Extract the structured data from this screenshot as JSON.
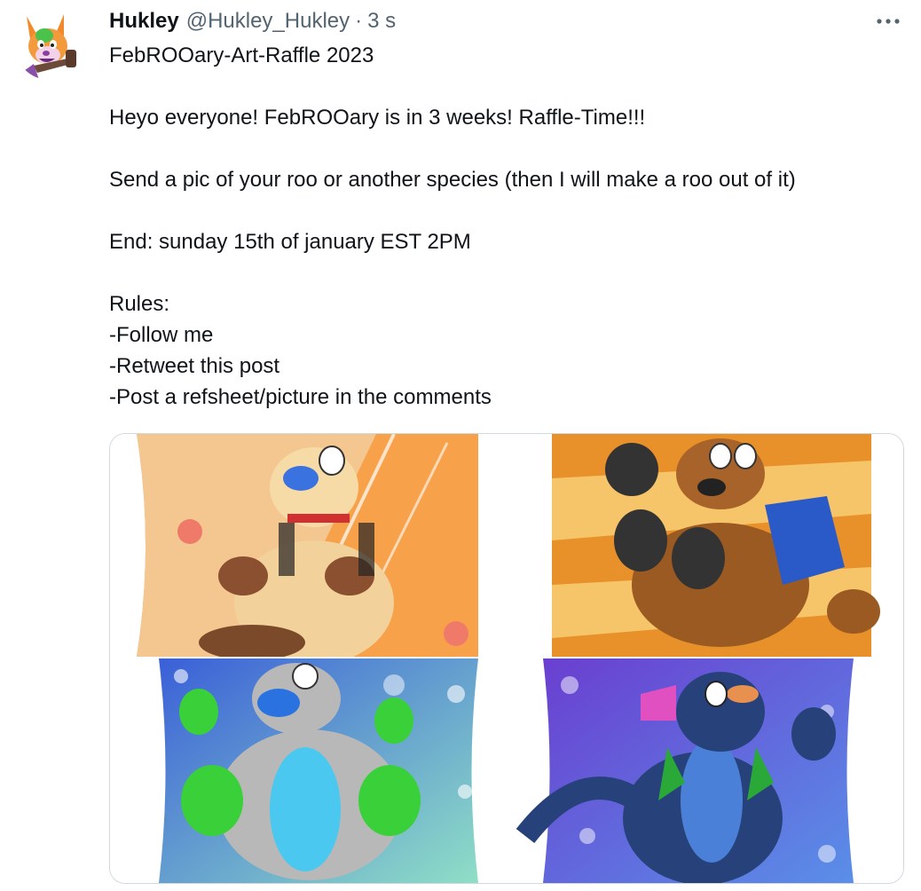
{
  "tweet": {
    "author_name": "Hukley",
    "author_handle": "@Hukley_Hukley",
    "separator": "·",
    "timestamp": "3 s",
    "lines": [
      "FebROOary-Art-Raffle 2023",
      "",
      "Heyo everyone! FebROOary is in 3 weeks! Raffle-Time!!!",
      "",
      "Send a pic of your roo or another species (then I will make a roo out of it)",
      "",
      "End: sunday 15th of january EST 2PM",
      "",
      "Rules:",
      "-Follow me",
      "-Retweet this post",
      "-Post a refsheet/picture in the comments"
    ]
  },
  "icons": {
    "more": "more-horizontal-icon",
    "avatar": "kangaroo-avatar"
  },
  "media": {
    "images": [
      {
        "name": "tan-kangaroo-art",
        "colors": [
          "#f7a24a",
          "#f4c690"
        ]
      },
      {
        "name": "brown-kangaroo-art",
        "colors": [
          "#e8902a",
          "#f6c469"
        ]
      },
      {
        "name": "teal-kangaroo-art",
        "colors": [
          "#3a5fd8",
          "#8fdfc6"
        ]
      },
      {
        "name": "navy-kangaroo-art",
        "colors": [
          "#6a3fd0",
          "#5a8fe8"
        ]
      }
    ]
  },
  "colors": {
    "text": "#0f1419",
    "secondary": "#536471",
    "border": "#cfd9de"
  }
}
